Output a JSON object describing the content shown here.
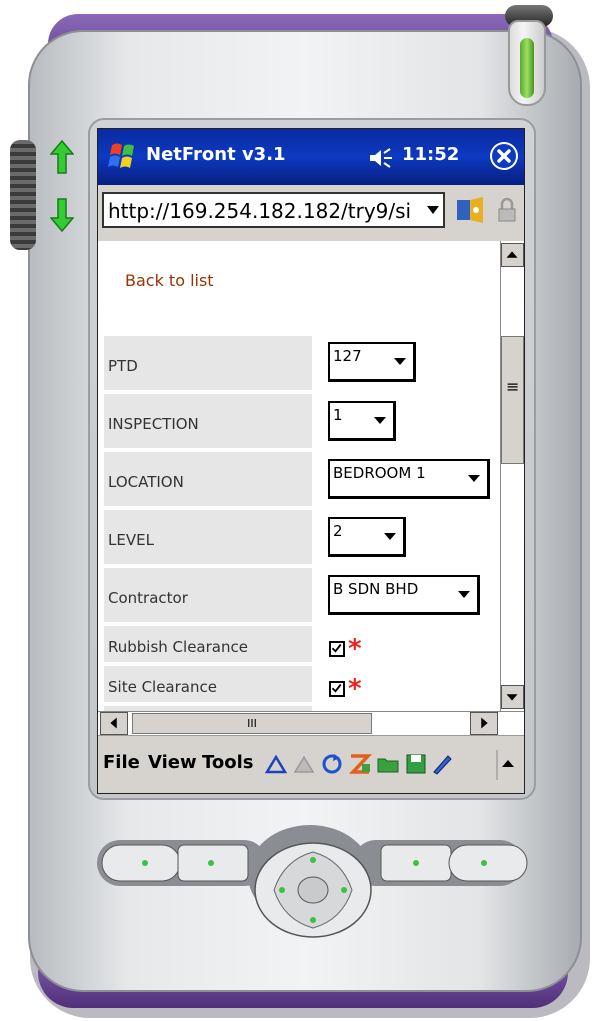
{
  "titlebar": {
    "app_title": "NetFront v3.1",
    "time": "11:52",
    "icons": [
      "windows-start-icon",
      "speaker-icon",
      "close-icon"
    ]
  },
  "address_bar": {
    "url": "http://169.254.182.182/try9/si"
  },
  "page": {
    "back_link": "Back to list",
    "fields": [
      {
        "label": "PTD",
        "value": "127"
      },
      {
        "label": "INSPECTION",
        "value": "1"
      },
      {
        "label": "LOCATION",
        "value": "BEDROOM 1"
      },
      {
        "label": "LEVEL",
        "value": "2"
      },
      {
        "label": "Contractor",
        "value": "B SDN BHD"
      }
    ],
    "checks": [
      {
        "label": "Rubbish Clearance",
        "checked": true,
        "required_mark": "*"
      },
      {
        "label": "Site Clearance",
        "checked": true,
        "required_mark": "*"
      }
    ]
  },
  "scrollbar": {
    "h_thumb_grip": "III",
    "v_thumb_grip": "≡"
  },
  "menu": {
    "file": "File",
    "view": "View",
    "tools": "Tools"
  },
  "colors": {
    "titlebar": "#0c3ac0",
    "link": "#993300",
    "required": "#ee2222",
    "device_purple": "#7a5aa8"
  }
}
